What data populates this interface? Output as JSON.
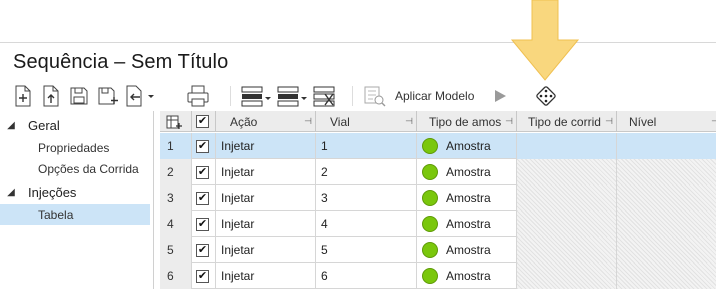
{
  "window": {
    "title": "Sequência – Sem Título"
  },
  "colors": {
    "accent_arrow": "#f9d77e",
    "selection": "#cce4f7",
    "sample_dot": "#7ac70c"
  },
  "toolbar": {
    "icons": [
      "new-icon",
      "upload-icon",
      "save-icon",
      "save-as-icon",
      "import-icon",
      "print-icon",
      "insert-row-icon",
      "move-row-icon",
      "delete-row-icon",
      "apply-model-icon",
      "play-icon",
      "dice-icon"
    ],
    "apply_model_label": "Aplicar Modelo"
  },
  "sidebar": {
    "groups": [
      {
        "label": "Geral",
        "items": [
          "Propriedades",
          "Opções da Corrida"
        ]
      },
      {
        "label": "Injeções",
        "items": [
          "Tabela"
        ]
      }
    ]
  },
  "grid": {
    "columns": [
      "Ação",
      "Vial",
      "Tipo de amos",
      "Tipo de corrid",
      "Nível"
    ],
    "rows": [
      {
        "n": "1",
        "checked": true,
        "action": "Injetar",
        "vial": "1",
        "type": "Amostra"
      },
      {
        "n": "2",
        "checked": true,
        "action": "Injetar",
        "vial": "2",
        "type": "Amostra"
      },
      {
        "n": "3",
        "checked": true,
        "action": "Injetar",
        "vial": "3",
        "type": "Amostra"
      },
      {
        "n": "4",
        "checked": true,
        "action": "Injetar",
        "vial": "4",
        "type": "Amostra"
      },
      {
        "n": "5",
        "checked": true,
        "action": "Injetar",
        "vial": "5",
        "type": "Amostra"
      },
      {
        "n": "6",
        "checked": true,
        "action": "Injetar",
        "vial": "6",
        "type": "Amostra"
      }
    ],
    "selected_row": 0
  }
}
